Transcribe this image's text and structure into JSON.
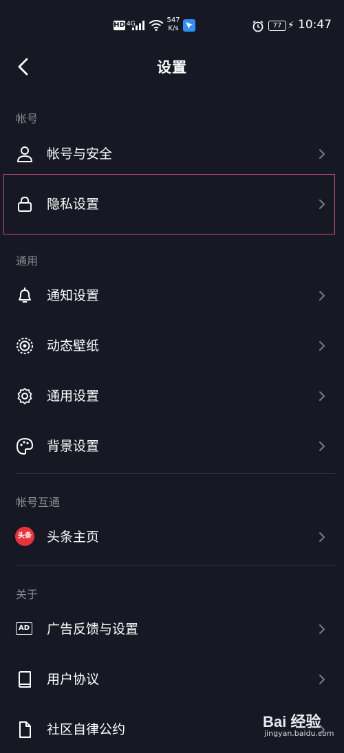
{
  "status_bar": {
    "hd": "HD",
    "network": "4G",
    "speed_value": "547",
    "speed_unit": "K/s",
    "battery": "77",
    "time": "10:47"
  },
  "header": {
    "title": "设置"
  },
  "sections": {
    "account": "帐号",
    "general": "通用",
    "linked": "帐号互通",
    "about": "关于"
  },
  "items": {
    "account_security": "帐号与安全",
    "privacy": "隐私设置",
    "notifications": "通知设置",
    "live_wallpaper": "动态壁纸",
    "general_settings": "通用设置",
    "background": "背景设置",
    "toutiao_badge": "头条",
    "toutiao": "头条主页",
    "ad_feedback": "广告反馈与设置",
    "ad_badge": "AD",
    "user_agreement": "用户协议",
    "community": "社区自律公约"
  },
  "watermark": {
    "brand": "Bai 经验",
    "url": "jingyan.baidu.com"
  },
  "colors": {
    "background": "#161823",
    "highlight": "#c8507a",
    "section_text": "#8a8b92"
  }
}
